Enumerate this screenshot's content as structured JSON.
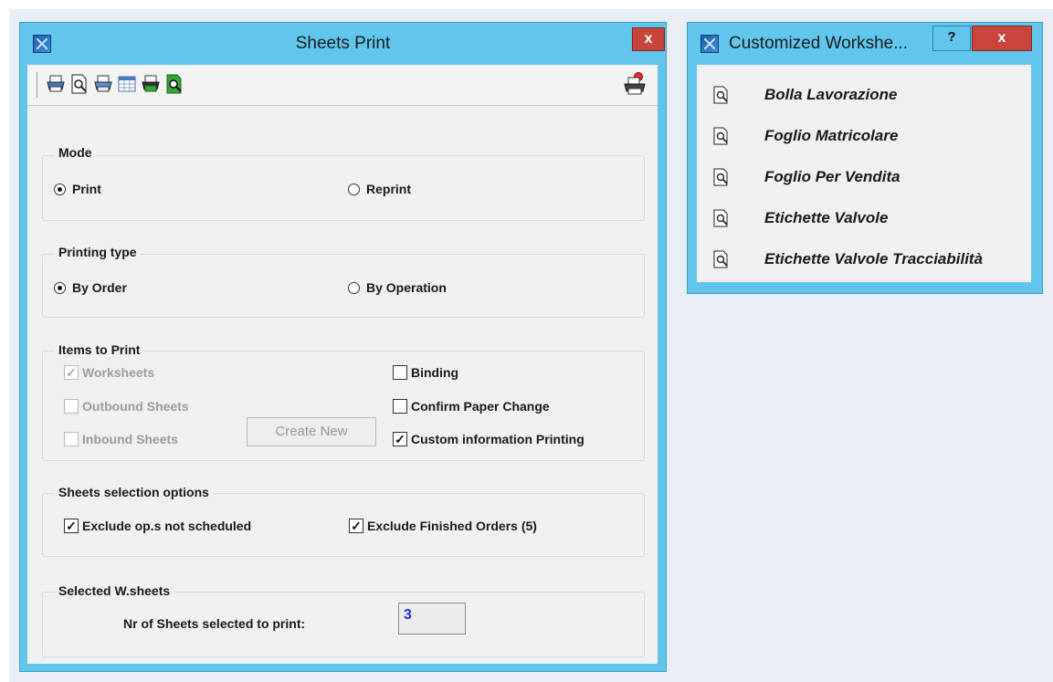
{
  "main_window": {
    "title": "Sheets Print",
    "close_label": "x",
    "toolbar": {
      "icons": [
        "print-icon",
        "print-preview-icon",
        "print-setup-icon",
        "calendar-grid-icon",
        "print-color-icon",
        "print-preview-color-icon",
        "print-options-icon"
      ]
    },
    "mode": {
      "label": "Mode",
      "options": [
        {
          "label": "Print",
          "selected": true
        },
        {
          "label": "Reprint",
          "selected": false
        }
      ]
    },
    "printing_type": {
      "label": "Printing type",
      "options": [
        {
          "label": "By Order",
          "selected": true
        },
        {
          "label": "By Operation",
          "selected": false
        }
      ]
    },
    "items_to_print": {
      "label": "Items to Print",
      "worksheets": {
        "label": "Worksheets",
        "checked": true,
        "enabled": false
      },
      "outbound": {
        "label": "Outbound Sheets",
        "checked": false,
        "enabled": false
      },
      "inbound": {
        "label": "Inbound Sheets",
        "checked": false,
        "enabled": false
      },
      "create_new": "Create New",
      "binding": {
        "label": "Binding",
        "checked": false
      },
      "confirm_paper": {
        "label": "Confirm Paper Change",
        "checked": false
      },
      "custom_info": {
        "label": "Custom information Printing",
        "checked": true
      }
    },
    "sheets_selection": {
      "label": "Sheets selection options",
      "exclude_not_scheduled": {
        "label": "Exclude op.s not scheduled",
        "checked": true
      },
      "exclude_finished": {
        "label": "Exclude Finished Orders (5)",
        "checked": true
      }
    },
    "selected": {
      "label": "Selected W.sheets",
      "count_label": "Nr of Sheets selected to print:",
      "count_value": "3"
    }
  },
  "side_window": {
    "title": "Customized Workshe...",
    "help_label": "?",
    "close_label": "x",
    "items": [
      {
        "label": "Bolla Lavorazione"
      },
      {
        "label": "Foglio Matricolare"
      },
      {
        "label": "Foglio Per Vendita"
      },
      {
        "label": "Etichette Valvole"
      },
      {
        "label": "Etichette Valvole Tracciabilità"
      }
    ]
  },
  "colors": {
    "window_frame": "#62c6ec",
    "close_button": "#c7453d",
    "client_background": "#f0f0f0",
    "value_text": "#1f2fd6"
  }
}
